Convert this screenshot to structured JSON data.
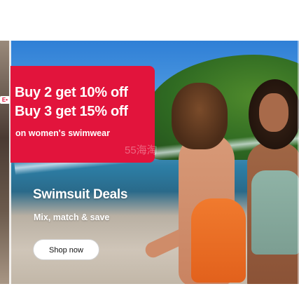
{
  "promo": {
    "line1": "Buy 2 get 10% off",
    "line2": "Buy 3 get 15% off",
    "sub": "on women's swimwear"
  },
  "watermark": "55海淘",
  "side_tag": "E•",
  "hero": {
    "title": "Swimsuit Deals",
    "subtitle": "Mix, match & save",
    "cta_label": "Shop now"
  },
  "colors": {
    "promo_bg": "#e2143c",
    "cta_bg": "#ffffff"
  }
}
